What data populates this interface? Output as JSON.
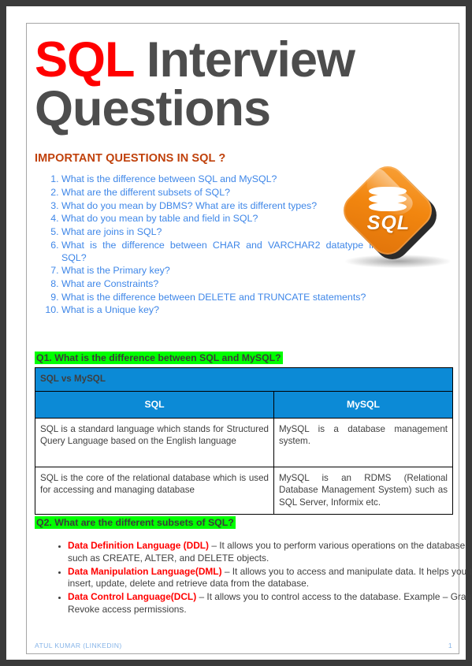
{
  "document": {
    "title_part_1": "SQL",
    "title_part_2": " Interview",
    "title_line_2": "Questions",
    "title_accent_color": "#ff0000",
    "title_color": "#4d4d4d"
  },
  "logo": {
    "name": "sql-logo",
    "text": "SQL",
    "color": "#f2860f"
  },
  "important_section": {
    "heading": "IMPORTANT QUESTIONS IN SQL ?",
    "heading_color": "#c0410b",
    "link_color": "#3f87e8",
    "questions": [
      "What is the difference between SQL and MySQL?",
      "What are the different subsets of SQL?",
      "What do you mean by DBMS? What are its different types?",
      "What do you mean by table and field in SQL?",
      "What are joins in SQL?",
      "What is the difference between CHAR and VARCHAR2 datatype in SQL?",
      "What is the Primary key?",
      "What are Constraints?",
      "What is the difference between DELETE and TRUNCATE statements?",
      "What is a Unique key?"
    ]
  },
  "q1": {
    "heading": "Q1. What is the difference between SQL and MySQL?",
    "highlight_color": "#00ff00",
    "table": {
      "caption": "SQL vs MySQL",
      "header_bg": "#0c8ad6",
      "columns": [
        "SQL",
        "MySQL"
      ],
      "rows": [
        [
          "SQL is a standard language which stands for Structured Query Language based on the English language",
          "MySQL is a database management system."
        ],
        [
          "SQL is the core of the relational database which is used for accessing and managing database",
          "MySQL is an RDMS (Relational Database Management System) such as SQL Server, Informix etc."
        ]
      ]
    }
  },
  "q2": {
    "heading": "Q2. What are the different subsets of SQL?",
    "highlight_color": "#00ff00",
    "bullets": [
      {
        "term": "Data Definition Language (DDL)",
        "description": " – It allows you to perform various operations on the database such as CREATE, ALTER, and DELETE objects."
      },
      {
        "term": "Data Manipulation Language(DML)",
        "description": " – It allows you to access and manipulate data. It helps you to insert, update, delete and retrieve data from the database."
      },
      {
        "term": "Data Control Language(DCL)",
        "description": " – It allows you to control access to the database. Example – Grant, Revoke access permissions."
      }
    ]
  },
  "footer": {
    "author": "ATUL KUMAR (LINKEDIN)",
    "page_number": "1",
    "color": "#86b4e8"
  }
}
